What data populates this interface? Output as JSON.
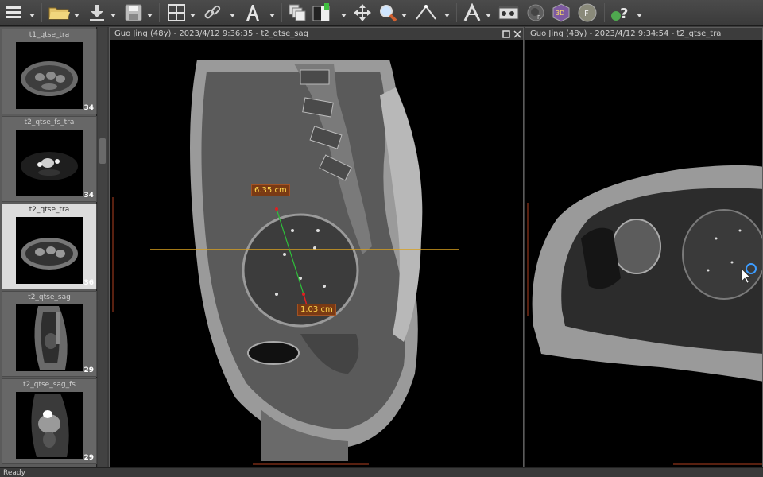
{
  "toolbar": {
    "icons": [
      "menu-icon",
      "open-folder-icon",
      "download-icon",
      "save-icon",
      "layout-grid-icon",
      "link-icon",
      "text-annotation-icon",
      "stack-icon",
      "window-level-icon",
      "pan-icon",
      "zoom-icon",
      "measure-angle-icon",
      "mpr-icon",
      "cine-icon",
      "3d-render-icon",
      "3d-volume-icon",
      "filter-icon",
      "help-icon"
    ]
  },
  "series": [
    {
      "label": "t1_qtse_tra",
      "count": "34",
      "selected": false
    },
    {
      "label": "t2_qtse_fs_tra",
      "count": "34",
      "selected": false
    },
    {
      "label": "t2_qtse_tra",
      "count": "36",
      "selected": true
    },
    {
      "label": "t2_qtse_sag",
      "count": "29",
      "selected": false
    },
    {
      "label": "t2_qtse_sag_fs",
      "count": "29",
      "selected": false
    }
  ],
  "viewports": {
    "left": {
      "header": "Guo Jing  (48y) - 2023/4/12 9:36:35 - t2_qtse_sag",
      "measurements": [
        {
          "label": "6.35 cm"
        },
        {
          "label": "1.03 cm"
        }
      ]
    },
    "right": {
      "header": "Guo Jing  (48y) - 2023/4/12 9:34:54 - t2_qtse_tra"
    }
  },
  "colors": {
    "reference_line": "#d8a020",
    "measure_line": "#2ec23a",
    "measure_end": "#e02020",
    "label_text": "#ffd84d"
  },
  "status": {
    "text": "Ready"
  }
}
